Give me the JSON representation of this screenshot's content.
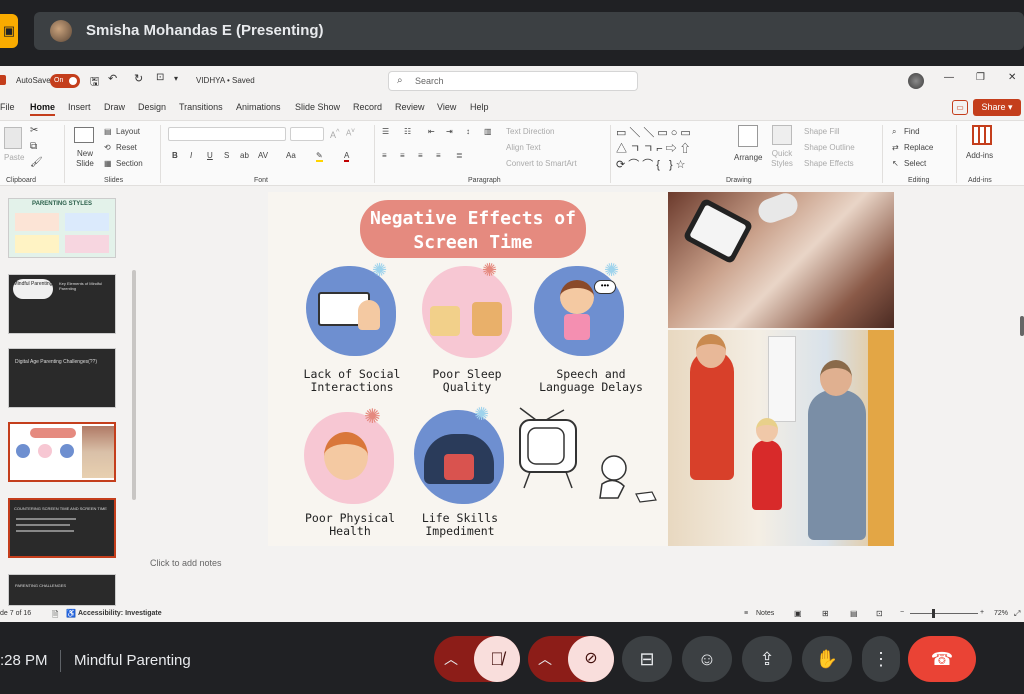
{
  "meet": {
    "presenter_name": "Smisha Mohandas E (Presenting)",
    "time": ":28 PM",
    "meeting_title": "Mindful Parenting"
  },
  "powerpoint": {
    "autosave_label": "AutoSave",
    "autosave_state": "On",
    "file_name": "VIDHYA • Saved",
    "search_placeholder": "Search",
    "menu_tabs": [
      "File",
      "Home",
      "Insert",
      "Draw",
      "Design",
      "Transitions",
      "Animations",
      "Slide Show",
      "Record",
      "Review",
      "View",
      "Help"
    ],
    "share_label": "Share",
    "ribbon": {
      "paste": "Paste",
      "new_slide": "New Slide",
      "layout": "Layout",
      "reset": "Reset",
      "section": "Section",
      "text_direction": "Text Direction",
      "align_text": "Align Text",
      "convert_smartart": "Convert to SmartArt",
      "arrange": "Arrange",
      "quick_styles": "Quick Styles",
      "shape_fill": "Shape Fill",
      "shape_outline": "Shape Outline",
      "shape_effects": "Shape Effects",
      "find": "Find",
      "replace": "Replace",
      "select": "Select",
      "addins": "Add-ins",
      "groups": {
        "clipboard": "Clipboard",
        "slides": "Slides",
        "font": "Font",
        "paragraph": "Paragraph",
        "drawing": "Drawing",
        "editing": "Editing",
        "addins": "Add-ins"
      }
    },
    "thumbnails": {
      "t1_title": "PARENTING STYLES",
      "t2_title": "Mindful Parenting",
      "t2_subtitle": "Key Elements of Mindful Parenting",
      "t3_title": "Digital Age Parenting Challenges(??)",
      "t5_title": "COUNTERING SCREEN TIME AND SCREEN TIME",
      "t6_title": "PARENTING CHALLENGES"
    },
    "slide": {
      "title_line1": "Negative Effects of",
      "title_line2": "Screen Time",
      "cards": [
        {
          "line1": "Lack of Social",
          "line2": "Interactions"
        },
        {
          "line1": "Poor Sleep",
          "line2": "Quality"
        },
        {
          "line1": "Speech and",
          "line2": "Language Delays"
        },
        {
          "line1": "Poor Physical",
          "line2": "Health"
        },
        {
          "line1": "Life Skills",
          "line2": "Impediment"
        }
      ]
    },
    "notes_placeholder": "Click to add notes",
    "status": {
      "slide_indicator": "de 7 of 16",
      "accessibility": "Accessibility: Investigate",
      "notes": "Notes",
      "zoom": "72%"
    }
  }
}
